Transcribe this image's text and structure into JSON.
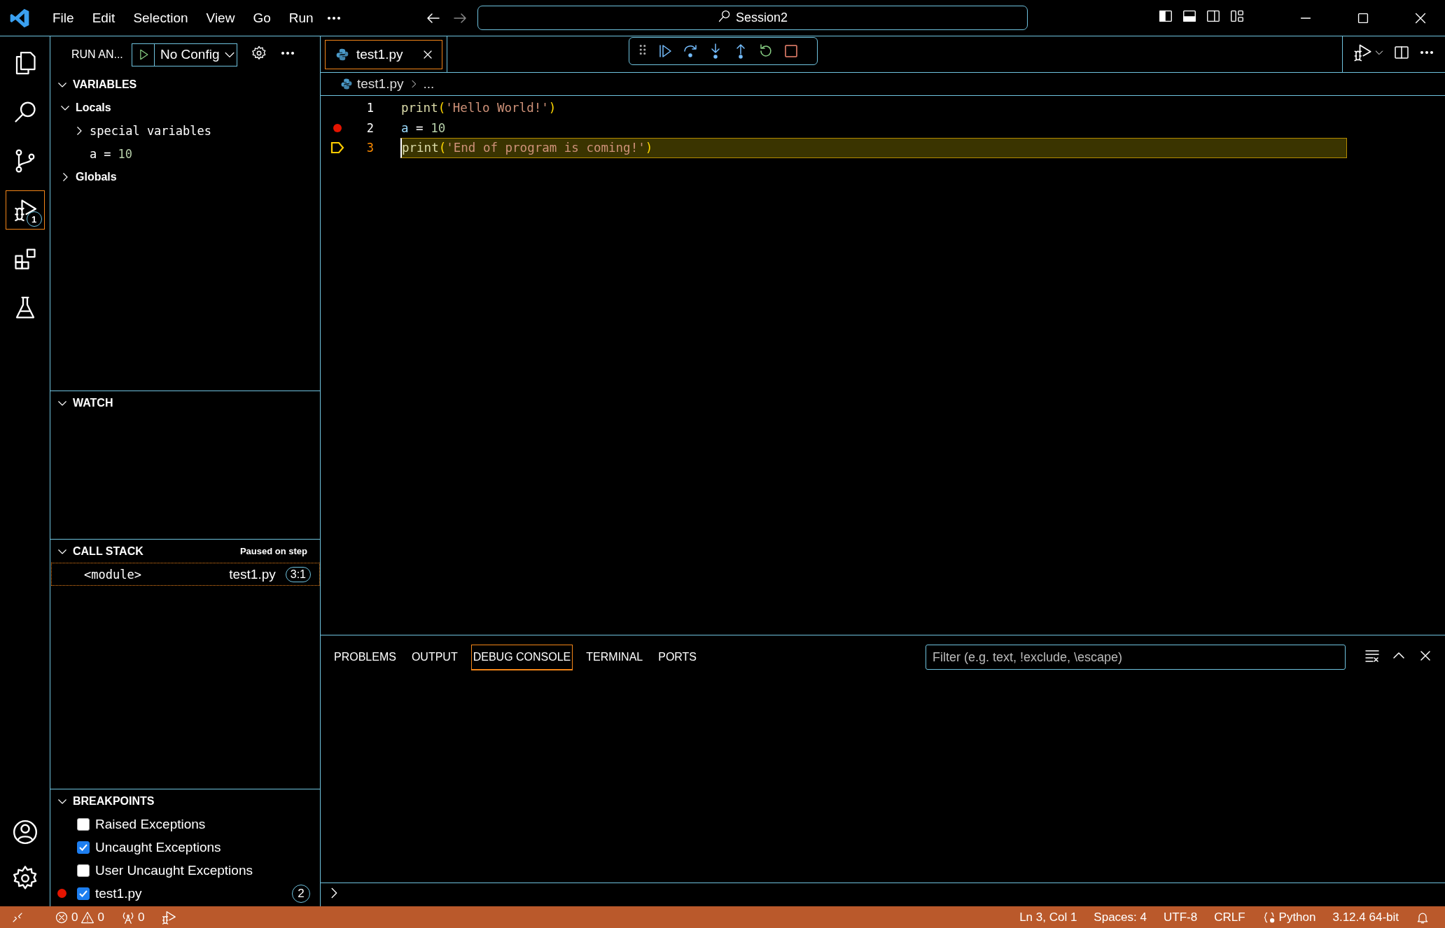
{
  "title_bar": {
    "menu": [
      "File",
      "Edit",
      "Selection",
      "View",
      "Go",
      "Run"
    ],
    "search": "Session2"
  },
  "activity_bar": {
    "items": [
      {
        "kind": "explorer",
        "selected": false
      },
      {
        "kind": "search",
        "selected": false
      },
      {
        "kind": "source-control",
        "selected": false
      },
      {
        "kind": "run-debug",
        "selected": true,
        "badge": "1"
      },
      {
        "kind": "extensions",
        "selected": false
      },
      {
        "kind": "testing",
        "selected": false
      }
    ],
    "bottom": [
      {
        "kind": "accounts"
      },
      {
        "kind": "settings"
      }
    ]
  },
  "sidebar": {
    "title": "RUN AN...",
    "configuration": "No Config",
    "variables": {
      "title": "VARIABLES",
      "expanded": true,
      "children": [
        {
          "kind": "scope",
          "label": "Locals",
          "expanded": true,
          "children": [
            {
              "kind": "group",
              "label": "special variables",
              "expanded": false
            },
            {
              "kind": "variable",
              "name": "a",
              "operator": "=",
              "value": "10"
            }
          ]
        },
        {
          "kind": "scope",
          "label": "Globals",
          "expanded": false
        }
      ]
    },
    "watch": {
      "title": "WATCH",
      "expanded": true
    },
    "call_stack": {
      "title": "CALL STACK",
      "expanded": true,
      "status": "Paused on step",
      "frames": [
        {
          "name": "<module>",
          "file": "test1.py",
          "position": "3:1",
          "selected": true
        }
      ]
    },
    "breakpoints": {
      "title": "BREAKPOINTS",
      "expanded": true,
      "items": [
        {
          "kind": "exception",
          "label": "Raised Exceptions",
          "checked": false
        },
        {
          "kind": "exception",
          "label": "Uncaught Exceptions",
          "checked": true
        },
        {
          "kind": "exception",
          "label": "User Uncaught Exceptions",
          "checked": false
        },
        {
          "kind": "file",
          "label": "test1.py",
          "checked": true,
          "line": "2"
        }
      ]
    }
  },
  "editor": {
    "tabs": [
      {
        "label": "test1.py",
        "selected": true
      }
    ],
    "breadcrumb": [
      "test1.py",
      "..."
    ],
    "lines": [
      {
        "number": "1",
        "breakpoint": false,
        "current": false,
        "tokens": [
          {
            "kind": "function",
            "text": "print"
          },
          {
            "kind": "bracket",
            "text": "("
          },
          {
            "kind": "string",
            "text": "'Hello World!'"
          },
          {
            "kind": "bracket",
            "text": ")"
          }
        ]
      },
      {
        "number": "2",
        "breakpoint": true,
        "current": false,
        "tokens": [
          {
            "kind": "variable",
            "text": "a"
          },
          {
            "kind": "operator",
            "text": " = "
          },
          {
            "kind": "number",
            "text": "10"
          }
        ]
      },
      {
        "number": "3",
        "breakpoint": false,
        "current": true,
        "tokens": [
          {
            "kind": "function",
            "text": "print"
          },
          {
            "kind": "bracket",
            "text": "("
          },
          {
            "kind": "string",
            "text": "'End of program is coming!'"
          },
          {
            "kind": "bracket",
            "text": ")"
          }
        ]
      }
    ]
  },
  "panel": {
    "tabs": [
      {
        "label": "PROBLEMS",
        "selected": false
      },
      {
        "label": "OUTPUT",
        "selected": false
      },
      {
        "label": "DEBUG CONSOLE",
        "selected": true
      },
      {
        "label": "TERMINAL",
        "selected": false
      },
      {
        "label": "PORTS",
        "selected": false
      }
    ],
    "filter": {
      "placeholder": "Filter (e.g. text, !exclude, \\escape)"
    }
  },
  "status_bar": {
    "errors": "0",
    "warnings": "0",
    "ports": "0",
    "right": [
      {
        "kind": "text",
        "text": "Ln 3, Col 1"
      },
      {
        "kind": "text",
        "text": "Spaces: 4"
      },
      {
        "kind": "text",
        "text": "UTF-8"
      },
      {
        "kind": "text",
        "text": "CRLF"
      },
      {
        "kind": "language",
        "text": "Python"
      },
      {
        "kind": "text",
        "text": "3.12.4 64-bit"
      }
    ]
  }
}
